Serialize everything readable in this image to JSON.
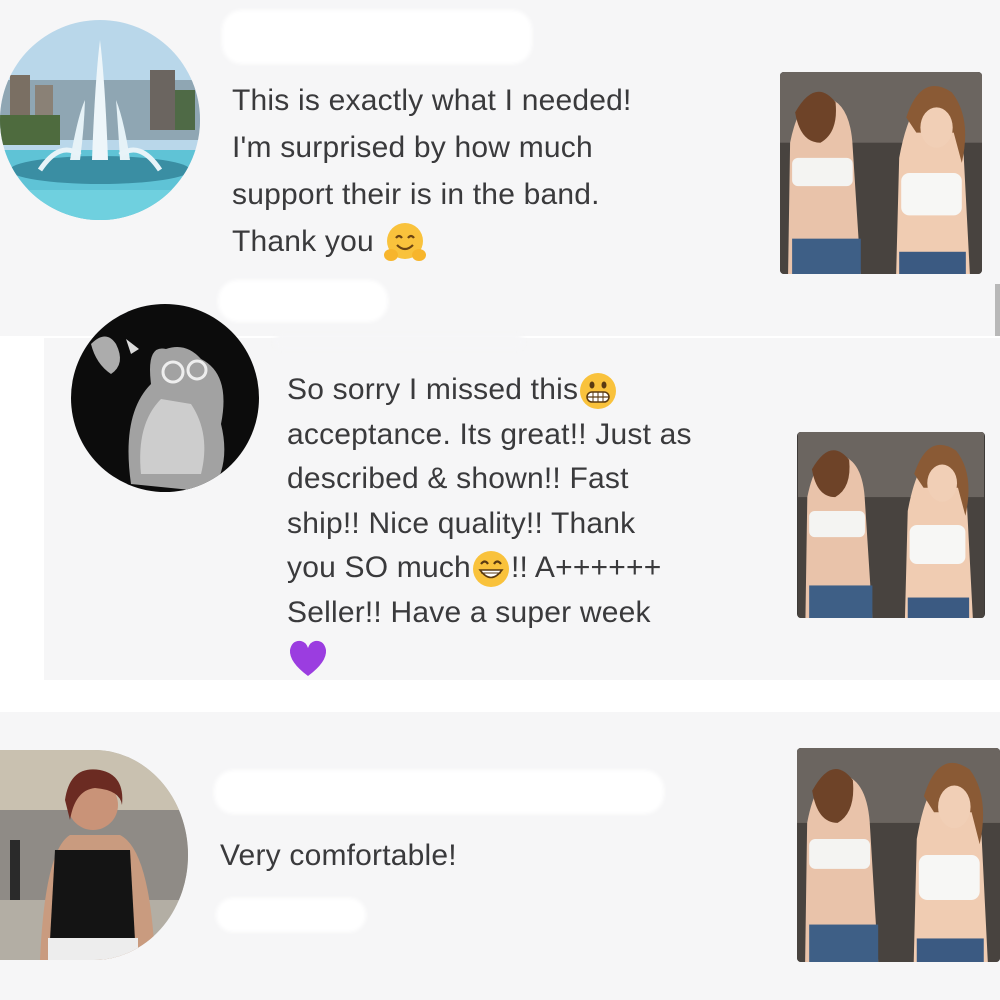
{
  "reviews": [
    {
      "text_lines": [
        "This is exactly what I needed!",
        "I'm surprised by how much",
        "support their is in the band.",
        "Thank you"
      ],
      "emoji": "hugging-face-icon",
      "avatar": "fountain-avatar"
    },
    {
      "text_lines": [
        "So sorry I missed this",
        "acceptance. Its great!! Just as",
        "described & shown!! Fast",
        "ship!! Nice quality!! Thank",
        "you SO much",
        "!! A++++++",
        "Seller!! Have a super week"
      ],
      "emoji": [
        "grimacing-face-icon",
        "grinning-face-icon",
        "purple-heart-icon"
      ],
      "avatar": "cat-drawing-avatar"
    },
    {
      "text_lines": [
        "Very comfortable!"
      ],
      "avatar": "woman-photo-avatar"
    }
  ],
  "colors": {
    "panel_bg": "#f6f6f7",
    "text": "#3a3a3c",
    "heart": "#9b3de0"
  }
}
